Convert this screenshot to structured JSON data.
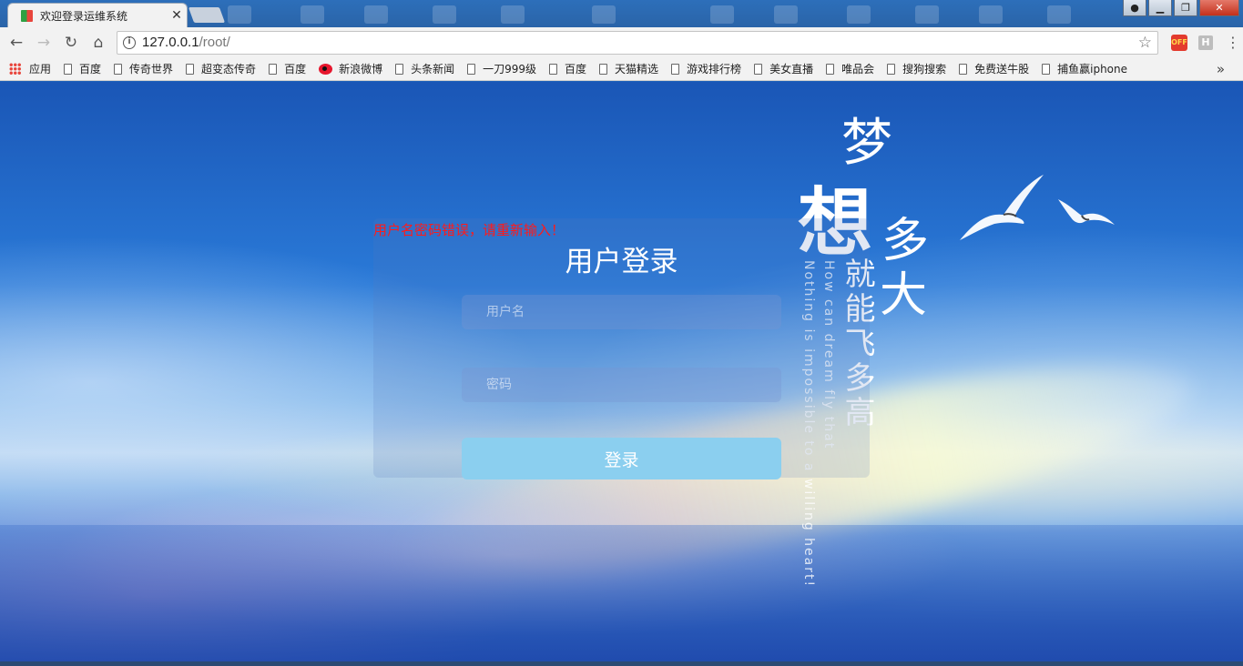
{
  "browser": {
    "tab": {
      "title": "欢迎登录运维系统"
    },
    "address": {
      "host": "127.0.0.1",
      "path": "/root/"
    },
    "extensions": {
      "ext1_label": "OFF",
      "ext2_label": "H"
    },
    "bookmarks": {
      "apps_label": "应用",
      "items": [
        "百度",
        "传奇世界",
        "超变态传奇",
        "百度",
        "新浪微博",
        "头条新闻",
        "一刀999级",
        "百度",
        "天猫精选",
        "游戏排行榜",
        "美女直播",
        "唯品会",
        "搜狗搜索",
        "免费送牛股",
        "捕鱼赢iphone"
      ],
      "more": "»"
    }
  },
  "login": {
    "error": "用户名密码错误，请重新输入！",
    "title": "用户登录",
    "username_placeholder": "用户名",
    "password_placeholder": "密码",
    "submit_label": "登录"
  },
  "slogan": {
    "meng": "梦",
    "xiang": "想",
    "duo": "多",
    "da": "大",
    "vertical": "就能飞多高",
    "english_1": "How can dream fly that",
    "english_2": "Nothing is impossible to a willing heart!"
  },
  "colors": {
    "error": "#ff1a1a",
    "button": "#8bcfef",
    "sky": "#1a56b6"
  }
}
